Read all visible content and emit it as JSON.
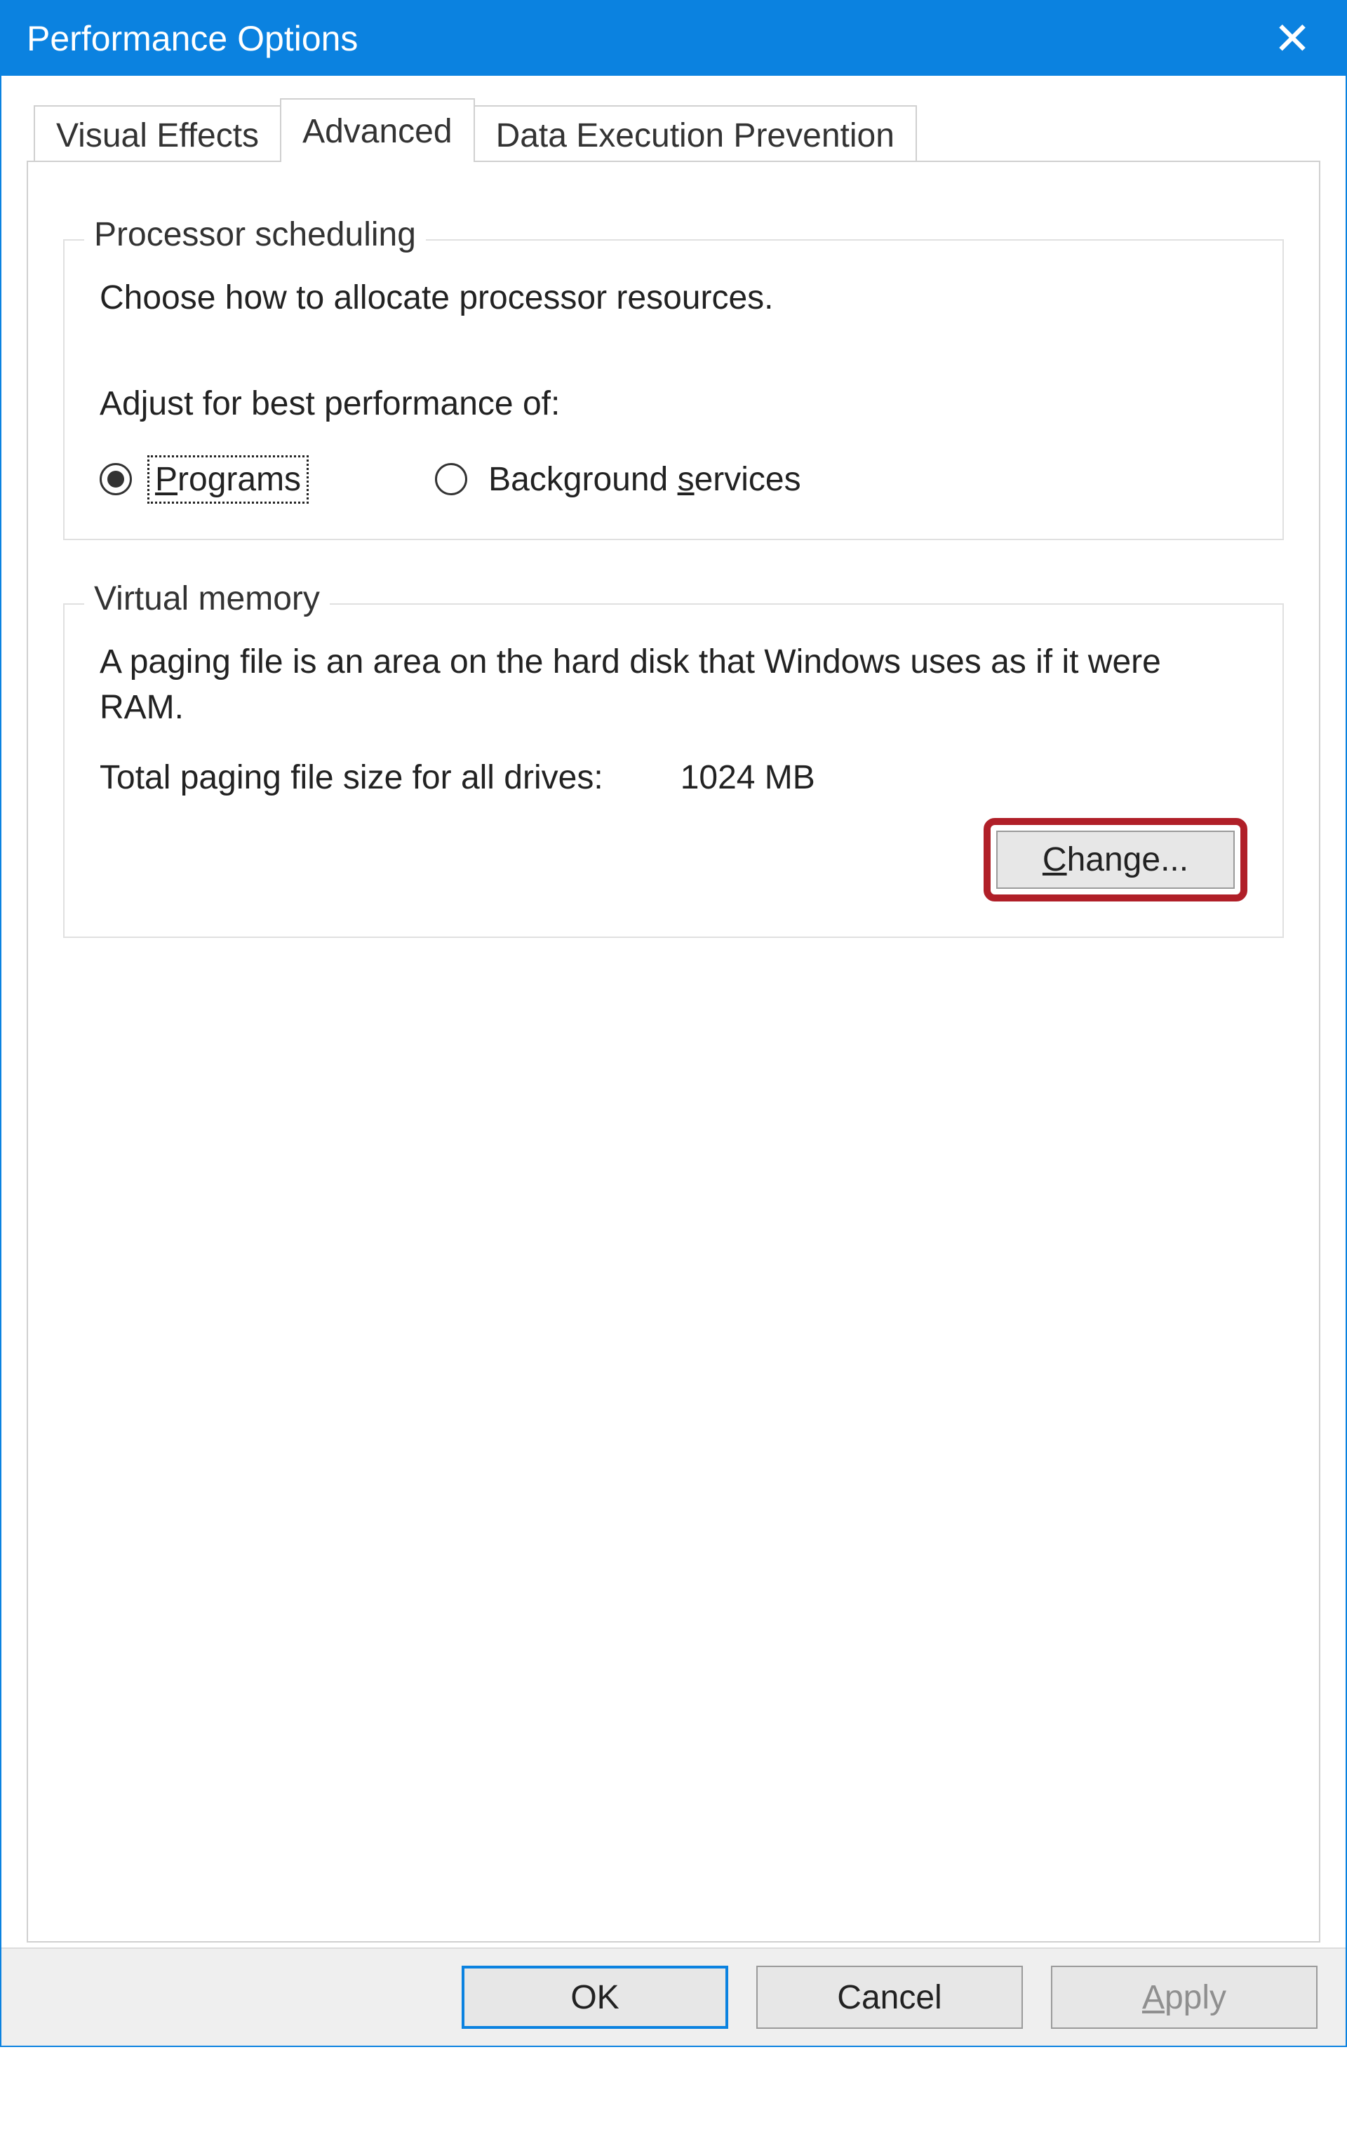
{
  "window": {
    "title": "Performance Options"
  },
  "tabs": {
    "visual_effects": "Visual Effects",
    "advanced": "Advanced",
    "dep": "Data Execution Prevention"
  },
  "processor": {
    "legend": "Processor scheduling",
    "description": "Choose how to allocate processor resources.",
    "adjust_label": "Adjust for best performance of:",
    "programs": "Programs",
    "background": "Background services",
    "bg_pre": "Background ",
    "bg_u": "s",
    "bg_post": "ervices"
  },
  "virtualmem": {
    "legend": "Virtual memory",
    "description": "A paging file is an area on the hard disk that Windows uses as if it were RAM.",
    "total_label": "Total paging file size for all drives:",
    "total_value": "1024 MB",
    "change_btn_u": "C",
    "change_btn_rest": "hange..."
  },
  "buttons": {
    "ok": "OK",
    "cancel": "Cancel",
    "apply_u": "A",
    "apply_rest": "pply"
  }
}
